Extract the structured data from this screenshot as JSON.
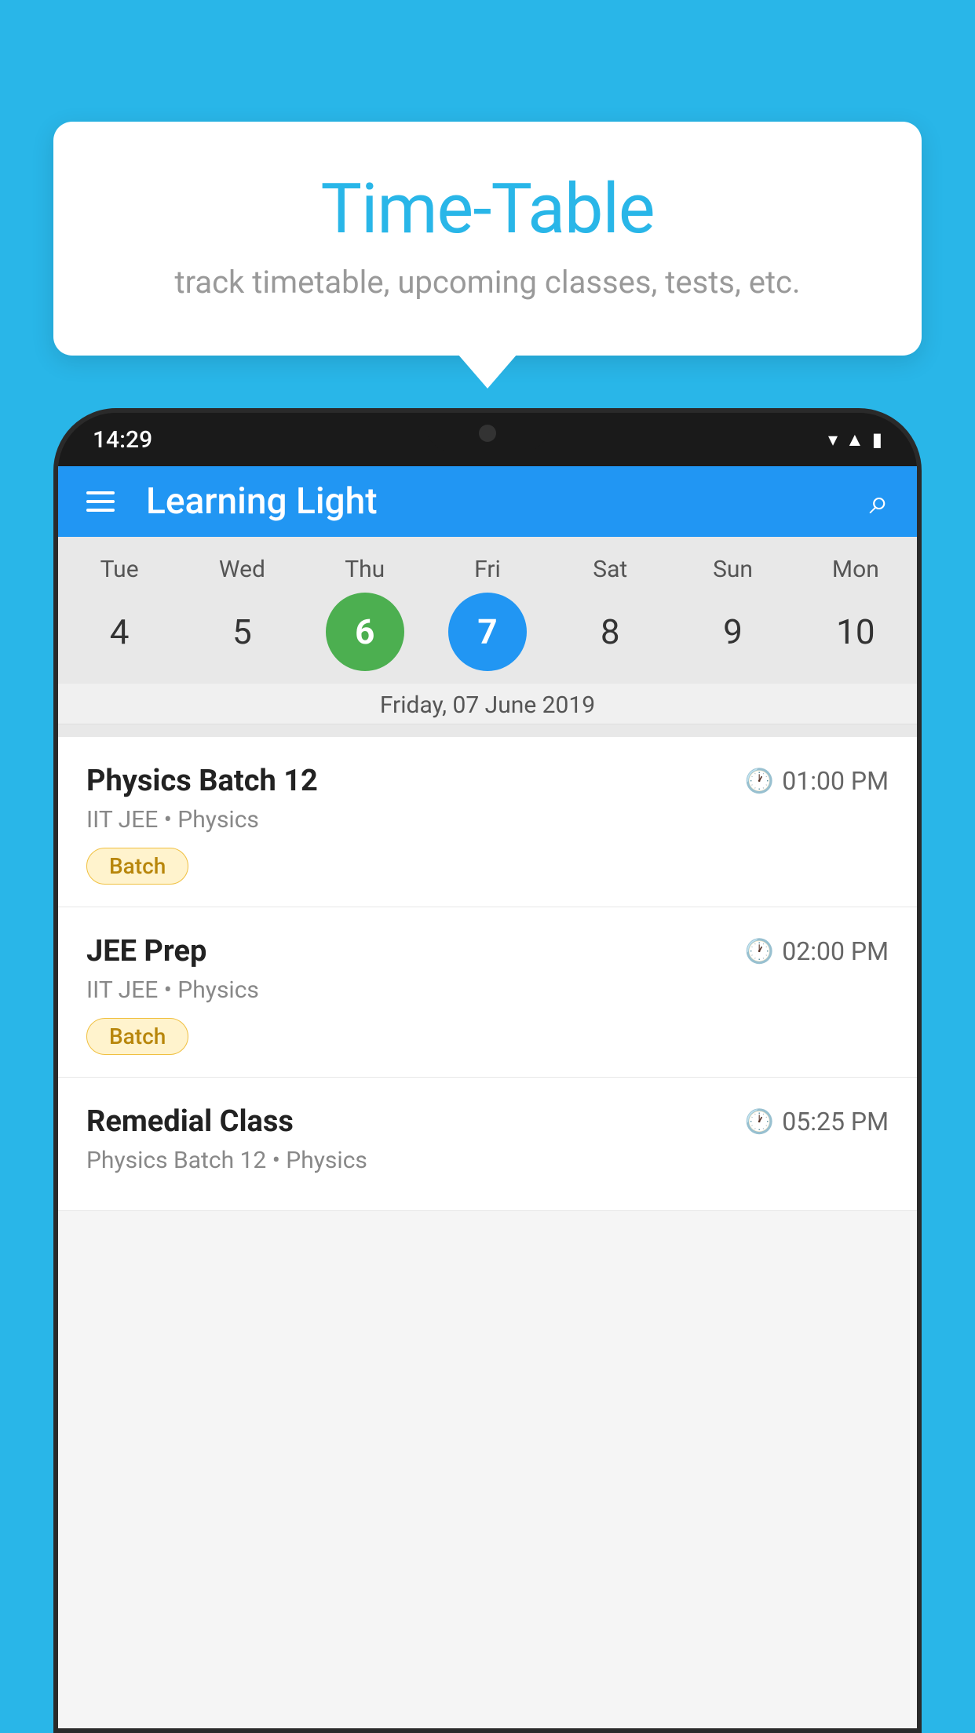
{
  "background": {
    "color": "#29B6E8"
  },
  "speech_bubble": {
    "title": "Time-Table",
    "subtitle": "track timetable, upcoming classes, tests, etc."
  },
  "phone": {
    "status_bar": {
      "time": "14:29"
    },
    "app_header": {
      "title": "Learning Light",
      "menu_icon": "hamburger-menu",
      "search_icon": "search"
    },
    "calendar": {
      "days": [
        "Tue",
        "Wed",
        "Thu",
        "Fri",
        "Sat",
        "Sun",
        "Mon"
      ],
      "dates": [
        4,
        5,
        6,
        7,
        8,
        9,
        10
      ],
      "today_index": 2,
      "selected_index": 3,
      "selected_label": "Friday, 07 June 2019"
    },
    "classes": [
      {
        "name": "Physics Batch 12",
        "time": "01:00 PM",
        "sub": "IIT JEE • Physics",
        "badge": "Batch"
      },
      {
        "name": "JEE Prep",
        "time": "02:00 PM",
        "sub": "IIT JEE • Physics",
        "badge": "Batch"
      },
      {
        "name": "Remedial Class",
        "time": "05:25 PM",
        "sub": "Physics Batch 12 • Physics",
        "badge": ""
      }
    ]
  }
}
